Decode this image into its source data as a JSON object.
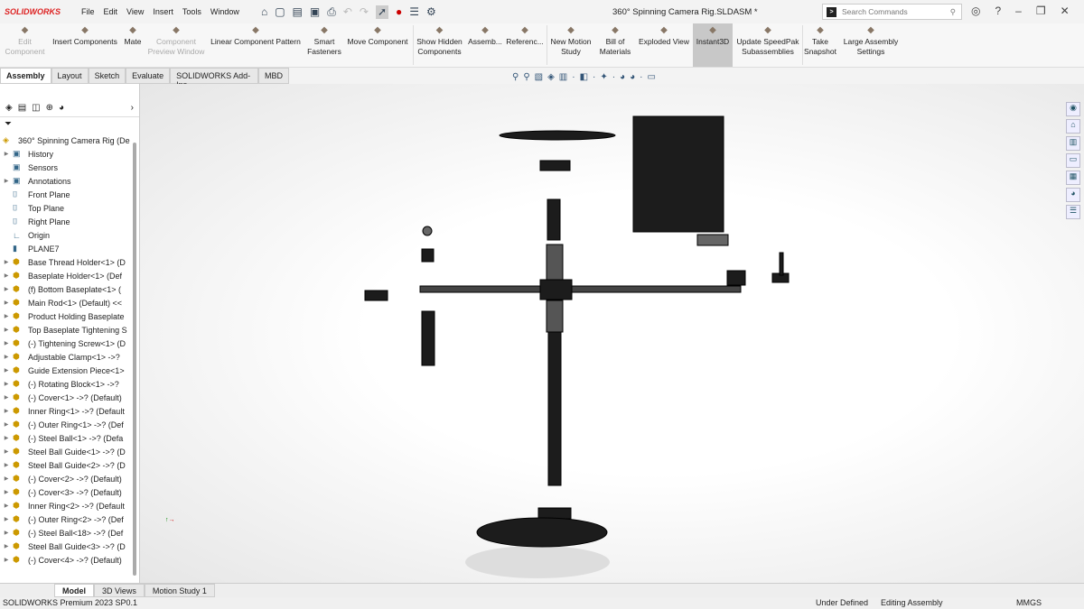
{
  "app": {
    "brand": "SOLIDWORKS",
    "window_title": "360° Spinning Camera Rig.SLDASM *"
  },
  "menu": [
    "File",
    "Edit",
    "View",
    "Insert",
    "Tools",
    "Window"
  ],
  "search": {
    "placeholder": "Search Commands"
  },
  "ribbon": [
    {
      "label": "Edit Component",
      "disabled": true
    },
    {
      "label": "Insert Components"
    },
    {
      "label": "Mate"
    },
    {
      "label": "Component Preview Window",
      "disabled": true
    },
    {
      "label": "Linear Component Pattern"
    },
    {
      "label": "Smart Fasteners"
    },
    {
      "label": "Move Component"
    },
    {
      "label": "Show Hidden Components"
    },
    {
      "label": "Assemb..."
    },
    {
      "label": "Referenc..."
    },
    {
      "label": "New Motion Study"
    },
    {
      "label": "Bill of Materials"
    },
    {
      "label": "Exploded View"
    },
    {
      "label": "Instant3D",
      "active": true
    },
    {
      "label": "Update SpeedPak Subassemblies"
    },
    {
      "label": "Take Snapshot"
    },
    {
      "label": "Large Assembly Settings"
    }
  ],
  "tabs": [
    "Assembly",
    "Layout",
    "Sketch",
    "Evaluate",
    "SOLIDWORKS Add-Ins",
    "MBD"
  ],
  "tree": {
    "root": "360° Spinning Camera Rig (De",
    "items": [
      "History",
      "Sensors",
      "Annotations",
      "Front Plane",
      "Top Plane",
      "Right Plane",
      "Origin",
      "PLANE7",
      "Base Thread Holder<1> (D",
      "Baseplate Holder<1> (Def",
      "(f) Bottom Baseplate<1> (",
      "Main Rod<1> (Default) <<",
      "Product Holding Baseplate",
      "Top Baseplate Tightening S",
      "(-) Tightening Screw<1> (D",
      "Adjustable Clamp<1> ->?",
      "Guide Extension Piece<1>",
      "(-) Rotating Block<1> ->?",
      "(-) Cover<1> ->? (Default)",
      "Inner Ring<1> ->? (Default",
      "(-) Outer Ring<1> ->? (Def",
      "(-) Steel Ball<1> ->? (Defa",
      "Steel Ball Guide<1> ->? (D",
      "Steel Ball Guide<2> ->? (D",
      "(-) Cover<2> ->? (Default)",
      "(-) Cover<3> ->? (Default)",
      "Inner Ring<2> ->? (Default",
      "(-) Outer Ring<2> ->? (Def",
      "(-) Steel Ball<18> ->? (Def",
      "Steel Ball Guide<3> ->? (D",
      "(-) Cover<4> ->? (Default)"
    ]
  },
  "bottom_tabs": [
    "Model",
    "3D Views",
    "Motion Study 1"
  ],
  "status": {
    "version": "SOLIDWORKS Premium 2023 SP0.1",
    "state": "Under Defined",
    "mode": "Editing Assembly",
    "units": "MMGS"
  }
}
